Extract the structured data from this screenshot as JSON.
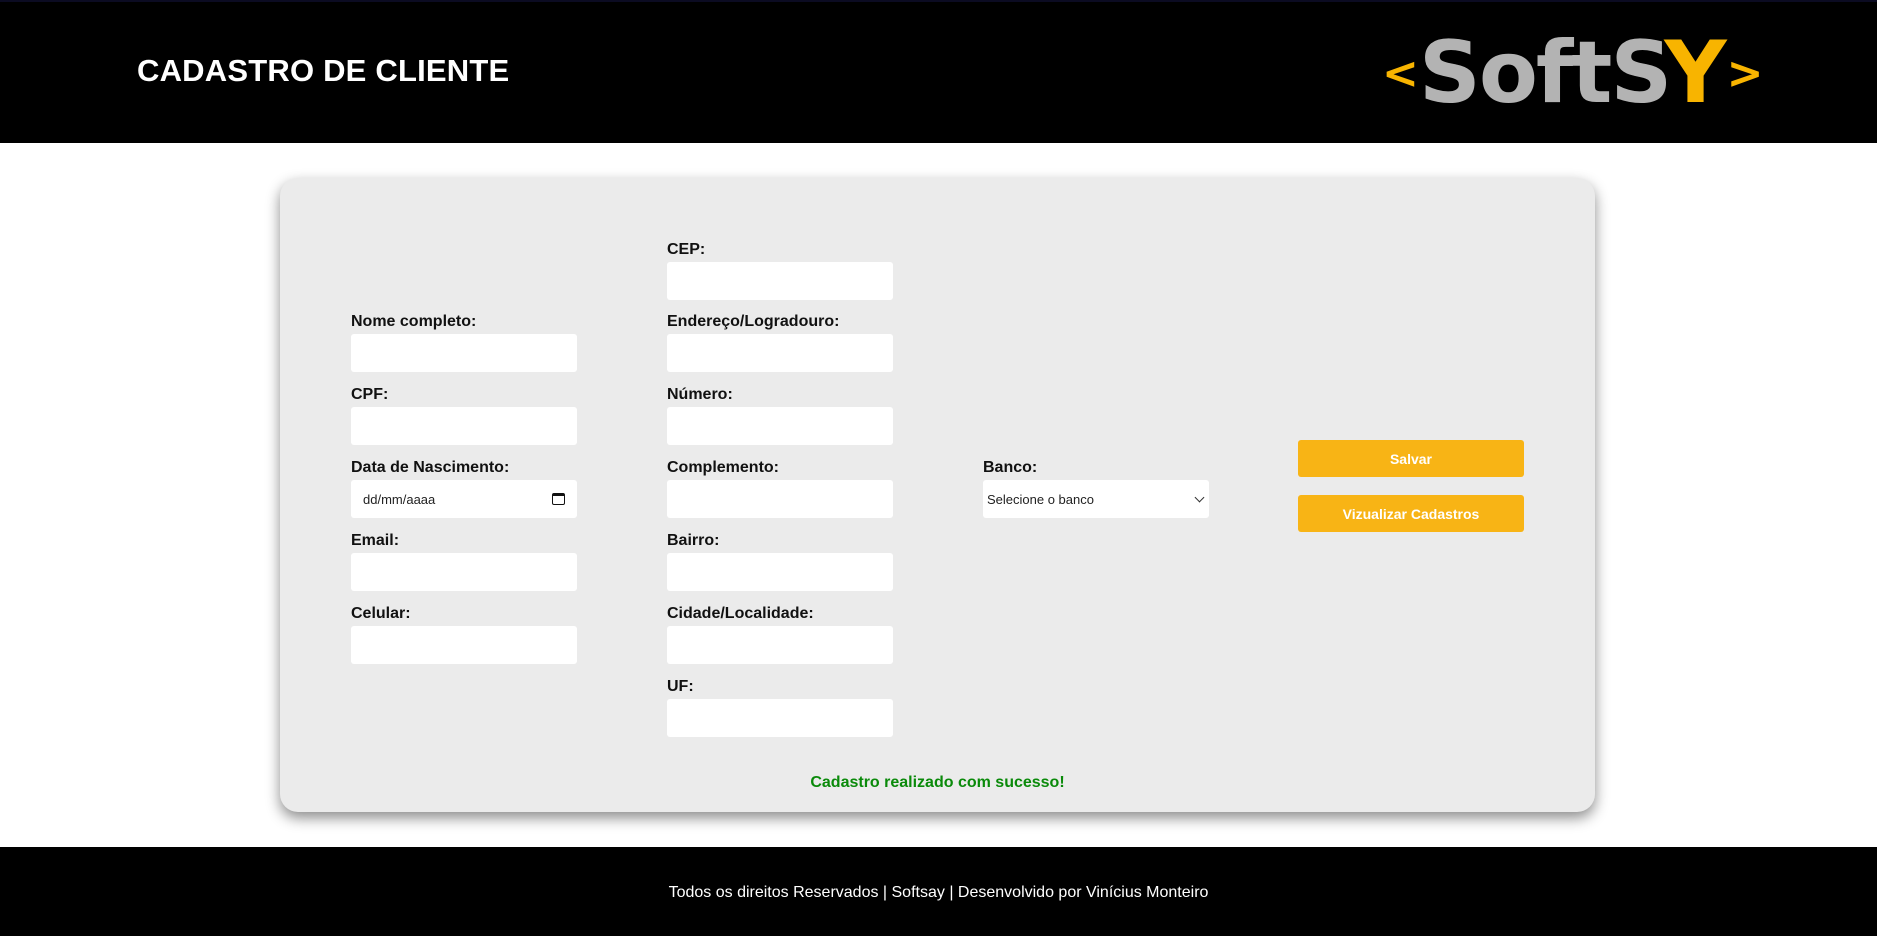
{
  "header": {
    "title": "CADASTRO DE CLIENTE",
    "logo": {
      "left_bracket": "<",
      "soft": "SoftS",
      "y": "Y",
      "right_bracket": ">"
    }
  },
  "form": {
    "nome": {
      "label": "Nome completo:",
      "value": ""
    },
    "cpf": {
      "label": "CPF:",
      "value": ""
    },
    "nascimento": {
      "label": "Data de Nascimento:",
      "placeholder": "dd/mm/aaaa"
    },
    "email": {
      "label": "Email:",
      "value": ""
    },
    "celular": {
      "label": "Celular:",
      "value": ""
    },
    "cep": {
      "label": "CEP:",
      "value": ""
    },
    "endereco": {
      "label": "Endereço/Logradouro:",
      "value": ""
    },
    "numero": {
      "label": "Número:",
      "value": ""
    },
    "complemento": {
      "label": "Complemento:",
      "value": ""
    },
    "bairro": {
      "label": "Bairro:",
      "value": ""
    },
    "cidade": {
      "label": "Cidade/Localidade:",
      "value": ""
    },
    "uf": {
      "label": "UF:",
      "value": ""
    },
    "banco": {
      "label": "Banco:",
      "selected": "Selecione o banco"
    }
  },
  "actions": {
    "save_label": "Salvar",
    "view_label": "Vizualizar Cadastros"
  },
  "status": {
    "message": "Cadastro realizado com sucesso!"
  },
  "footer": {
    "text": "Todos os direitos Reservados | Softsay | Desenvolvido por Vinícius Monteiro"
  },
  "colors": {
    "accent": "#f8b415",
    "success": "#0a8a0a",
    "card": "#ebebeb",
    "header": "#000000"
  }
}
